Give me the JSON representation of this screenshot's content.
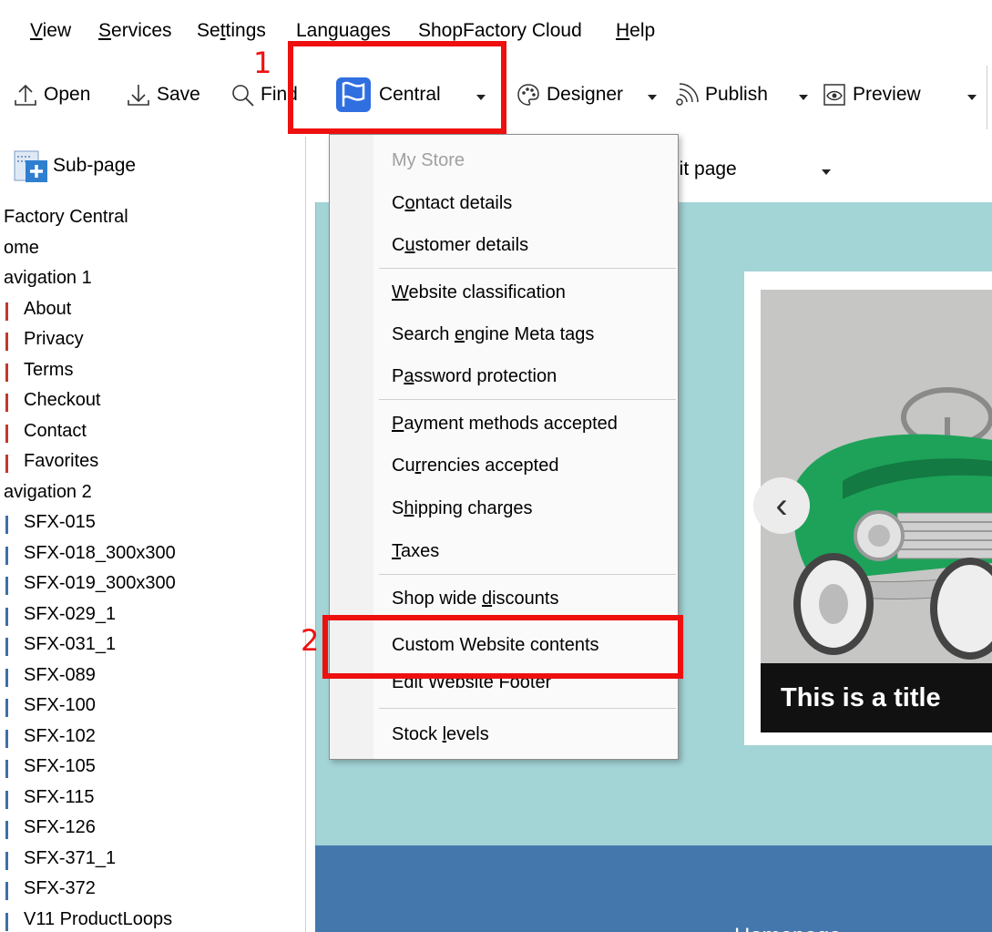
{
  "menubar": {
    "items": [
      {
        "pre": "",
        "u": "V",
        "post": "iew"
      },
      {
        "pre": "",
        "u": "S",
        "post": "ervices"
      },
      {
        "pre": "Se",
        "u": "t",
        "post": "tings"
      },
      {
        "pre": "",
        "u": "",
        "post": "Languages"
      },
      {
        "pre": "ShopFactory Cloud",
        "u": "",
        "post": ""
      },
      {
        "pre": "",
        "u": "H",
        "post": "elp"
      }
    ]
  },
  "toolbar": {
    "open": "Open",
    "save": "Save",
    "find": "Find",
    "central": "Central",
    "designer": "Designer",
    "publish": "Publish",
    "preview": "Preview"
  },
  "sidebar": {
    "subpage": "Sub-page",
    "tree": [
      {
        "label": "Factory Central",
        "level": 0
      },
      {
        "label": "ome",
        "level": 0
      },
      {
        "label": "avigation 1",
        "level": 0
      },
      {
        "label": "About",
        "level": 1,
        "color": "#c0392b"
      },
      {
        "label": "Privacy",
        "level": 1,
        "color": "#c0392b"
      },
      {
        "label": "Terms",
        "level": 1,
        "color": "#c0392b"
      },
      {
        "label": "Checkout",
        "level": 1,
        "color": "#c0392b"
      },
      {
        "label": "Contact",
        "level": 1,
        "color": "#c0392b"
      },
      {
        "label": "Favorites",
        "level": 1,
        "color": "#c0392b"
      },
      {
        "label": "avigation 2",
        "level": 0
      },
      {
        "label": "SFX-015",
        "level": 1,
        "color": "#3e6ea8"
      },
      {
        "label": "SFX-018_300x300",
        "level": 1,
        "color": "#3e6ea8"
      },
      {
        "label": "SFX-019_300x300",
        "level": 1,
        "color": "#3e6ea8"
      },
      {
        "label": "SFX-029_1",
        "level": 1,
        "color": "#3e6ea8"
      },
      {
        "label": "SFX-031_1",
        "level": 1,
        "color": "#3e6ea8"
      },
      {
        "label": "SFX-089",
        "level": 1,
        "color": "#3e6ea8"
      },
      {
        "label": "SFX-100",
        "level": 1,
        "color": "#3e6ea8"
      },
      {
        "label": "SFX-102",
        "level": 1,
        "color": "#3e6ea8"
      },
      {
        "label": "SFX-105",
        "level": 1,
        "color": "#3e6ea8"
      },
      {
        "label": "SFX-115",
        "level": 1,
        "color": "#3e6ea8"
      },
      {
        "label": "SFX-126",
        "level": 1,
        "color": "#3e6ea8"
      },
      {
        "label": "SFX-371_1",
        "level": 1,
        "color": "#3e6ea8"
      },
      {
        "label": "SFX-372",
        "level": 1,
        "color": "#3e6ea8"
      },
      {
        "label": "V11 ProductLoops",
        "level": 1,
        "color": "#3e6ea8"
      }
    ]
  },
  "editor": {
    "tab_label": "dit page",
    "slider_caption": "This is a title",
    "footer_text": "Homepage"
  },
  "dropdown": {
    "header": "My Store",
    "items": [
      {
        "pre": "C",
        "u": "o",
        "post": "ntact details"
      },
      {
        "pre": "C",
        "u": "u",
        "post": "stomer details"
      },
      {
        "pre": "",
        "u": "W",
        "post": "ebsite classification"
      },
      {
        "pre": "Search ",
        "u": "e",
        "post": "ngine Meta tags"
      },
      {
        "pre": "P",
        "u": "a",
        "post": "ssword protection"
      },
      {
        "pre": "",
        "u": "P",
        "post": "ayment methods accepted"
      },
      {
        "pre": "Cu",
        "u": "r",
        "post": "rencies accepted"
      },
      {
        "pre": "S",
        "u": "h",
        "post": "ipping charges"
      },
      {
        "pre": "",
        "u": "T",
        "post": "axes"
      },
      {
        "pre": "Shop wide ",
        "u": "d",
        "post": "iscounts"
      },
      {
        "pre": "Custom Website contents",
        "u": "",
        "post": ""
      },
      {
        "pre": "Edit Website Footer",
        "u": "",
        "post": ""
      },
      {
        "pre": "Stock ",
        "u": "l",
        "post": "evels"
      }
    ]
  },
  "annotations": {
    "label1": "1",
    "label2": "2",
    "color": "#ee0f0f"
  },
  "colors": {
    "central_icon": "#2f6fe0",
    "canvas_bg": "#a3d4d6",
    "footer_band": "#4478ad"
  }
}
